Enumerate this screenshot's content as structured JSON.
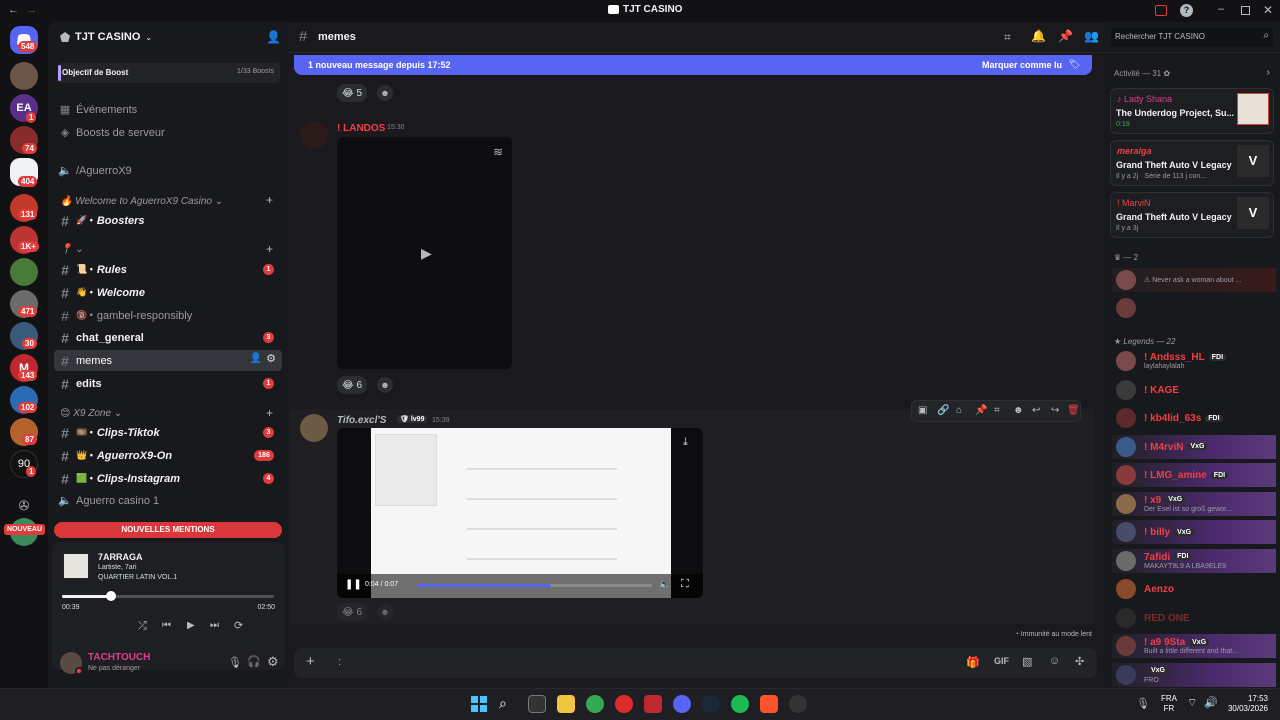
{
  "window": {
    "title": "TJT CASINO"
  },
  "servers": {
    "badges": [
      "548",
      "1",
      "74",
      "404",
      "131",
      "1K+",
      "471",
      "30",
      "143",
      "102",
      "87",
      "1"
    ],
    "new_label": "NOUVEAU"
  },
  "sidebar": {
    "server_name": "TJT CASINO",
    "boost": {
      "label": "Objectif de Boost",
      "count": "1/33 Boosts"
    },
    "links": [
      "Événements",
      "Boosts de serveur"
    ],
    "voice_top": "/AguerroX9",
    "category1": "Welcome to AguerroX9 Casino",
    "category2": "",
    "category3": "X9 Zone",
    "channels": [
      {
        "name": "Boosters",
        "emoji": "🚀 •",
        "badge": ""
      },
      {
        "name": "Rules",
        "emoji": "📜 •",
        "badge": "1"
      },
      {
        "name": "Welcome",
        "emoji": "👋 •",
        "badge": ""
      },
      {
        "name": "gambel-responsibly",
        "emoji": "🔞 •",
        "badge": ""
      },
      {
        "name": "chat_general",
        "emoji": "",
        "badge": "3"
      },
      {
        "name": "memes",
        "emoji": "",
        "badge": ""
      },
      {
        "name": "edits",
        "emoji": "",
        "badge": "1"
      },
      {
        "name": "Clips-Tiktok",
        "emoji": "🎞️ •",
        "badge": "3"
      },
      {
        "name": "AguerroX9-On",
        "emoji": "👑 •",
        "badge": "186"
      },
      {
        "name": "Clips-Instagram",
        "emoji": "🟩 •",
        "badge": "4"
      }
    ],
    "voice_bottom": "Aguerro casino 1",
    "mentions_label": "NOUVELLES MENTIONS"
  },
  "player": {
    "title": "7ARRAGA",
    "artist": "Lartiste, 7ari",
    "album": "QUARTIER LATIN VOL.1",
    "elapsed": "00:39",
    "duration": "02:50",
    "progress": 0.23
  },
  "user": {
    "name": "TACHTOUCH",
    "status": "Ne pas déranger"
  },
  "channel_header": {
    "name": "memes",
    "search_placeholder": "Rechercher TJT CASINO"
  },
  "new_banner": {
    "text": "1 nouveau message depuis 17:52",
    "action": "Marquer comme lu"
  },
  "messages": [
    {
      "author": "! LANDOS",
      "time": "15:30",
      "reaction": "6"
    },
    {
      "author": "Tifo.excl'S",
      "tag": "lv99",
      "time": "15:39",
      "reaction": "6",
      "video_time": "0:04 / 0:07",
      "video_progress": 0.57
    }
  ],
  "top_reaction": "5",
  "composer": {
    "placeholder": ":"
  },
  "immunity_note": "Immunité au mode lent",
  "members": {
    "activity_header": "Activité — 31",
    "activities": [
      {
        "name": "Lady Shana",
        "game": "The Underdog Project, Su...",
        "sub": "0:19"
      },
      {
        "name": "meraiga",
        "game": "Grand Theft Auto V Legacy",
        "sub": "Il y a 2j · Série de 113 j con..."
      },
      {
        "name": "! MarviN",
        "game": "Grand Theft Auto V Legacy",
        "sub": "Il y a 3j"
      }
    ],
    "group1_header": "— 2",
    "group1_status": "Never ask a woman about ...",
    "legends_header": "Legends — 22",
    "legends": [
      {
        "name": "! Andsss_HL",
        "tag": "FDI",
        "status": "laylahaylalah",
        "color": "#f23f43"
      },
      {
        "name": "! KAGE",
        "tag": "",
        "status": "",
        "color": "#f23f43"
      },
      {
        "name": "! kb4lid_63s",
        "tag": "FDI",
        "status": "",
        "color": "#f23f43"
      },
      {
        "name": "! M4rviN",
        "tag": "VxG",
        "status": "",
        "color": "#f23f43"
      },
      {
        "name": "! LMG_amine",
        "tag": "FDI",
        "status": "",
        "color": "#f23f43"
      },
      {
        "name": "! x9",
        "tag": "VxG",
        "status": "Der Esel ist so groß gewor...",
        "color": "#f23f43"
      },
      {
        "name": "! billy",
        "tag": "VxG",
        "status": "",
        "color": "#f23f43"
      },
      {
        "name": "7afidi",
        "tag": "FDI",
        "status": "MAKAYT9L9 A LBA9ELE9",
        "color": "#f23f43"
      },
      {
        "name": "Aenzo",
        "tag": "",
        "status": "",
        "color": "#f23f43"
      },
      {
        "name": "RED ONE",
        "tag": "",
        "status": "",
        "color": "#7a2b2b"
      },
      {
        "name": "! a9 9Sta",
        "tag": "VxG",
        "status": "Built a little different and that...",
        "color": "#f23f43"
      },
      {
        "name": "",
        "tag": "VxG",
        "status": "FRO",
        "color": "#f23f43"
      }
    ]
  },
  "taskbar": {
    "lang": "FRA",
    "region": "FR",
    "time": "17:53",
    "date": "30/03/2026"
  }
}
